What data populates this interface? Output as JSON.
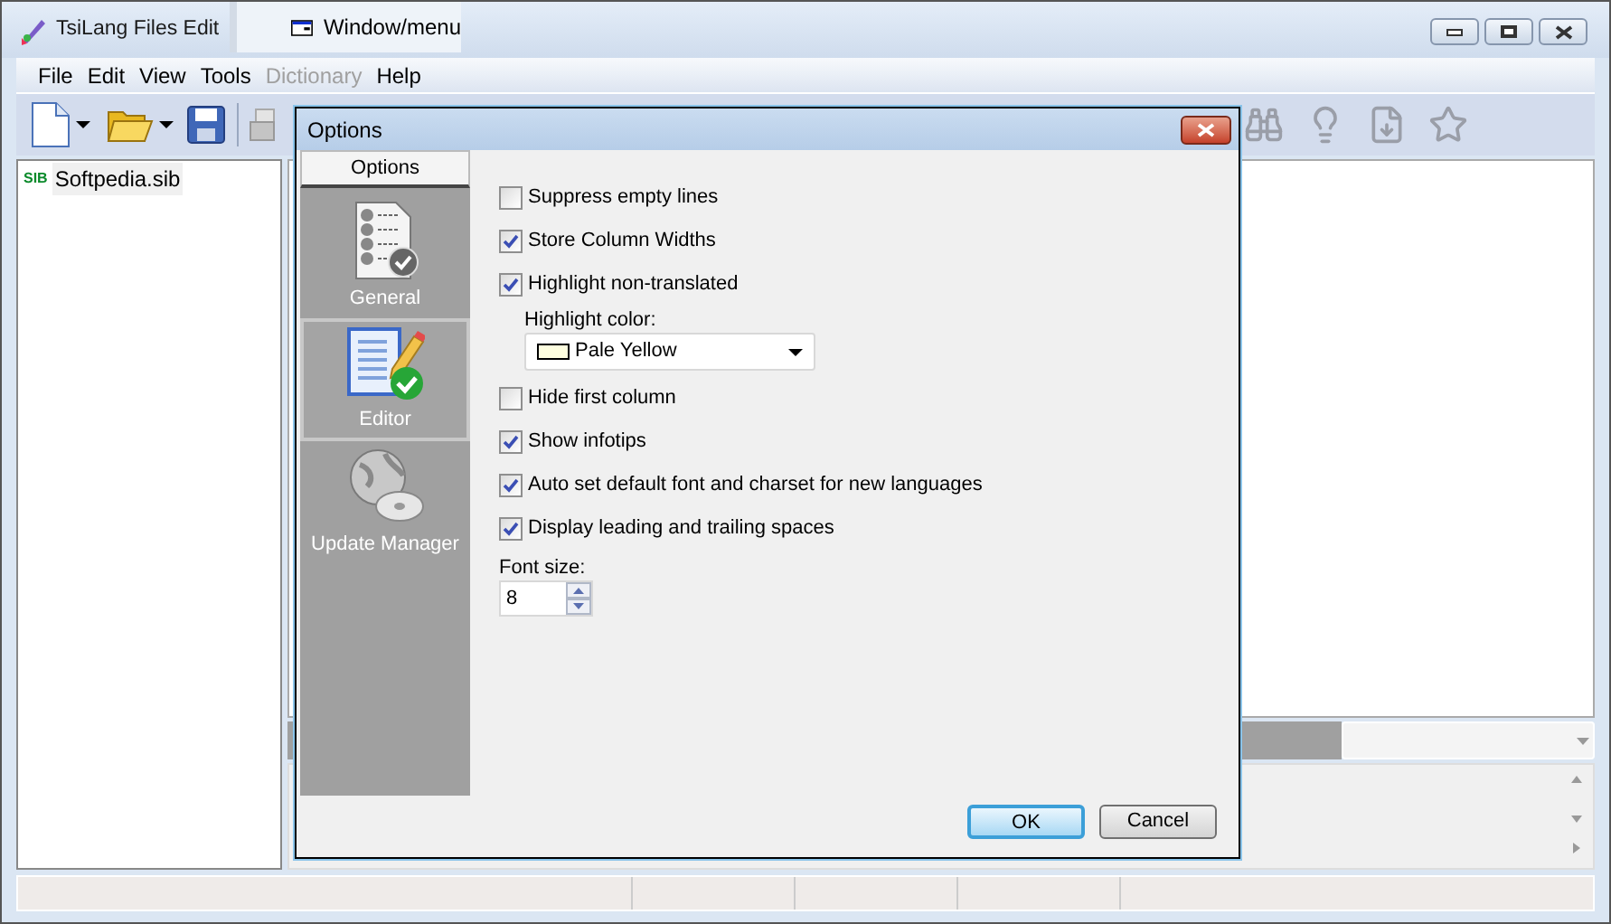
{
  "window": {
    "title": "TsiLang Files Edit"
  },
  "window_menu_popup": {
    "label": "Window/menu"
  },
  "menu": [
    {
      "label": "File",
      "disabled": false
    },
    {
      "label": "Edit",
      "disabled": false
    },
    {
      "label": "View",
      "disabled": false
    },
    {
      "label": "Tools",
      "disabled": false
    },
    {
      "label": "Dictionary",
      "disabled": true
    },
    {
      "label": "Help",
      "disabled": false
    }
  ],
  "tree": {
    "items": [
      {
        "label": "Softpedia.sib",
        "badge": "SIB"
      }
    ]
  },
  "dialog": {
    "title": "Options",
    "sidebar": {
      "header": "Options",
      "items": [
        {
          "label": "General",
          "kind": "general",
          "selected": false
        },
        {
          "label": "Editor",
          "kind": "editor",
          "selected": true
        },
        {
          "label": "Update Manager",
          "kind": "update",
          "selected": false
        }
      ]
    },
    "settings": [
      {
        "kind": "checkbox",
        "label": "Suppress empty lines",
        "checked": false
      },
      {
        "kind": "checkbox",
        "label": "Store Column Widths",
        "checked": true
      },
      {
        "kind": "checkbox",
        "label": "Highlight non-translated",
        "checked": true
      },
      {
        "kind": "dropdown",
        "label": "Highlight color:",
        "value": "Pale Yellow",
        "color": "#ffffe0"
      },
      {
        "kind": "checkbox",
        "label": "Hide first column",
        "checked": false
      },
      {
        "kind": "checkbox",
        "label": "Show infotips",
        "checked": true
      },
      {
        "kind": "checkbox",
        "label": "Auto set default font and charset for new languages",
        "checked": true
      },
      {
        "kind": "checkbox",
        "label": "Display leading and trailing spaces",
        "checked": true
      },
      {
        "kind": "spin",
        "label": "Font size:",
        "value": "8"
      }
    ],
    "buttons": [
      {
        "label": "OK",
        "default": true
      },
      {
        "label": "Cancel",
        "default": false
      }
    ]
  }
}
